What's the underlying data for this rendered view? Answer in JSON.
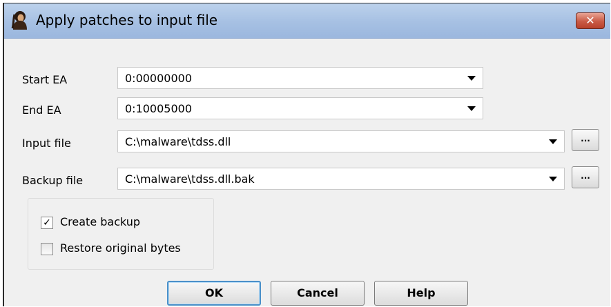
{
  "window": {
    "title": "Apply patches to input file",
    "close_label": "✕"
  },
  "fields": {
    "start_ea": {
      "label": "Start EA",
      "value": "0:00000000"
    },
    "end_ea": {
      "label": "End EA",
      "value": "0:10005000"
    },
    "input_file": {
      "label": "Input file",
      "value": "C:\\malware\\tdss.dll",
      "browse_label": "..."
    },
    "backup_file": {
      "label": "Backup file",
      "value": "C:\\malware\\tdss.dll.bak",
      "browse_label": "..."
    }
  },
  "options": {
    "create_backup": {
      "label": "Create backup",
      "checked": true,
      "check_glyph": "✓"
    },
    "restore_original": {
      "label": "Restore original bytes",
      "checked": false
    }
  },
  "buttons": {
    "ok": "OK",
    "cancel": "Cancel",
    "help": "Help"
  }
}
